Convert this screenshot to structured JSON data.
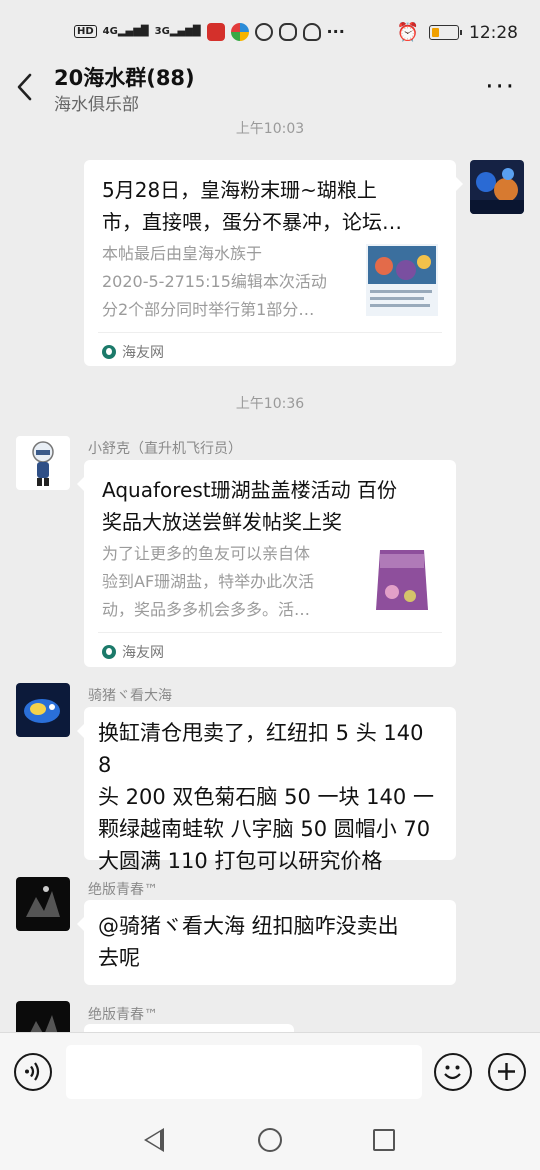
{
  "status_bar": {
    "left_badges": [
      "HD",
      "4G",
      "3G"
    ],
    "time": "12:28",
    "icons": [
      "hd-icon",
      "signal-4g-icon",
      "signal-3g-icon",
      "app-icon-red",
      "app-icon-color",
      "app-icon-weibo",
      "app-icon-baidu",
      "app-icon-qq",
      "more-dots-icon",
      "alarm-icon",
      "battery-icon"
    ],
    "battery_level": 0.2
  },
  "header": {
    "title": "20海水群(88)",
    "subtitle": "海水俱乐部",
    "more": "···"
  },
  "messages": [
    {
      "type": "timestamp",
      "text": "上午10:03"
    },
    {
      "type": "link_card",
      "side": "right",
      "title_lines": [
        "5月28日，皇海粉末珊~瑚粮上",
        "市，直接喂，蛋分不暴冲，论坛…"
      ],
      "desc_lines": [
        "本帖最后由皇海水族于",
        "2020-5-2715:15编辑本次活动",
        "分2个部分同时举行第1部分…"
      ],
      "source": "海友网"
    },
    {
      "type": "timestamp",
      "text": "上午10:36"
    },
    {
      "type": "link_card",
      "side": "left",
      "sender": "小舒克（直升机飞行员）",
      "title_lines": [
        "Aquaforest珊湖盐盖楼活动 百份",
        "奖品大放送尝鲜发帖奖上奖"
      ],
      "desc_lines": [
        "为了让更多的鱼友可以亲自体",
        "验到AF珊湖盐，特举办此次活",
        "动，奖品多多机会多多。活…"
      ],
      "source": "海友网"
    },
    {
      "type": "text",
      "side": "left",
      "sender": "骑猪ヾ看大海",
      "lines": [
        "换缸清仓甩卖了，红纽扣 5 头 140 8",
        "头 200 双色菊石脑 50 一块 140 一",
        "颗绿越南蛙软 八字脑 50 圆帽小 70",
        "大圆满 110 打包可以研究价格"
      ]
    },
    {
      "type": "text",
      "side": "left",
      "sender": "绝版青春™",
      "lines": [
        "@骑猪ヾ看大海 纽扣脑咋没卖出",
        "去呢"
      ]
    },
    {
      "type": "text",
      "side": "left",
      "sender": "绝版青春™",
      "lines": []
    }
  ],
  "input_bar": {
    "voice_icon": "voice-icon",
    "emoji_icon": "emoji-icon",
    "plus_icon": "plus-icon",
    "placeholder": ""
  },
  "nav_bar": {
    "icons": [
      "nav-back-icon",
      "nav-home-icon",
      "nav-recent-icon"
    ]
  }
}
